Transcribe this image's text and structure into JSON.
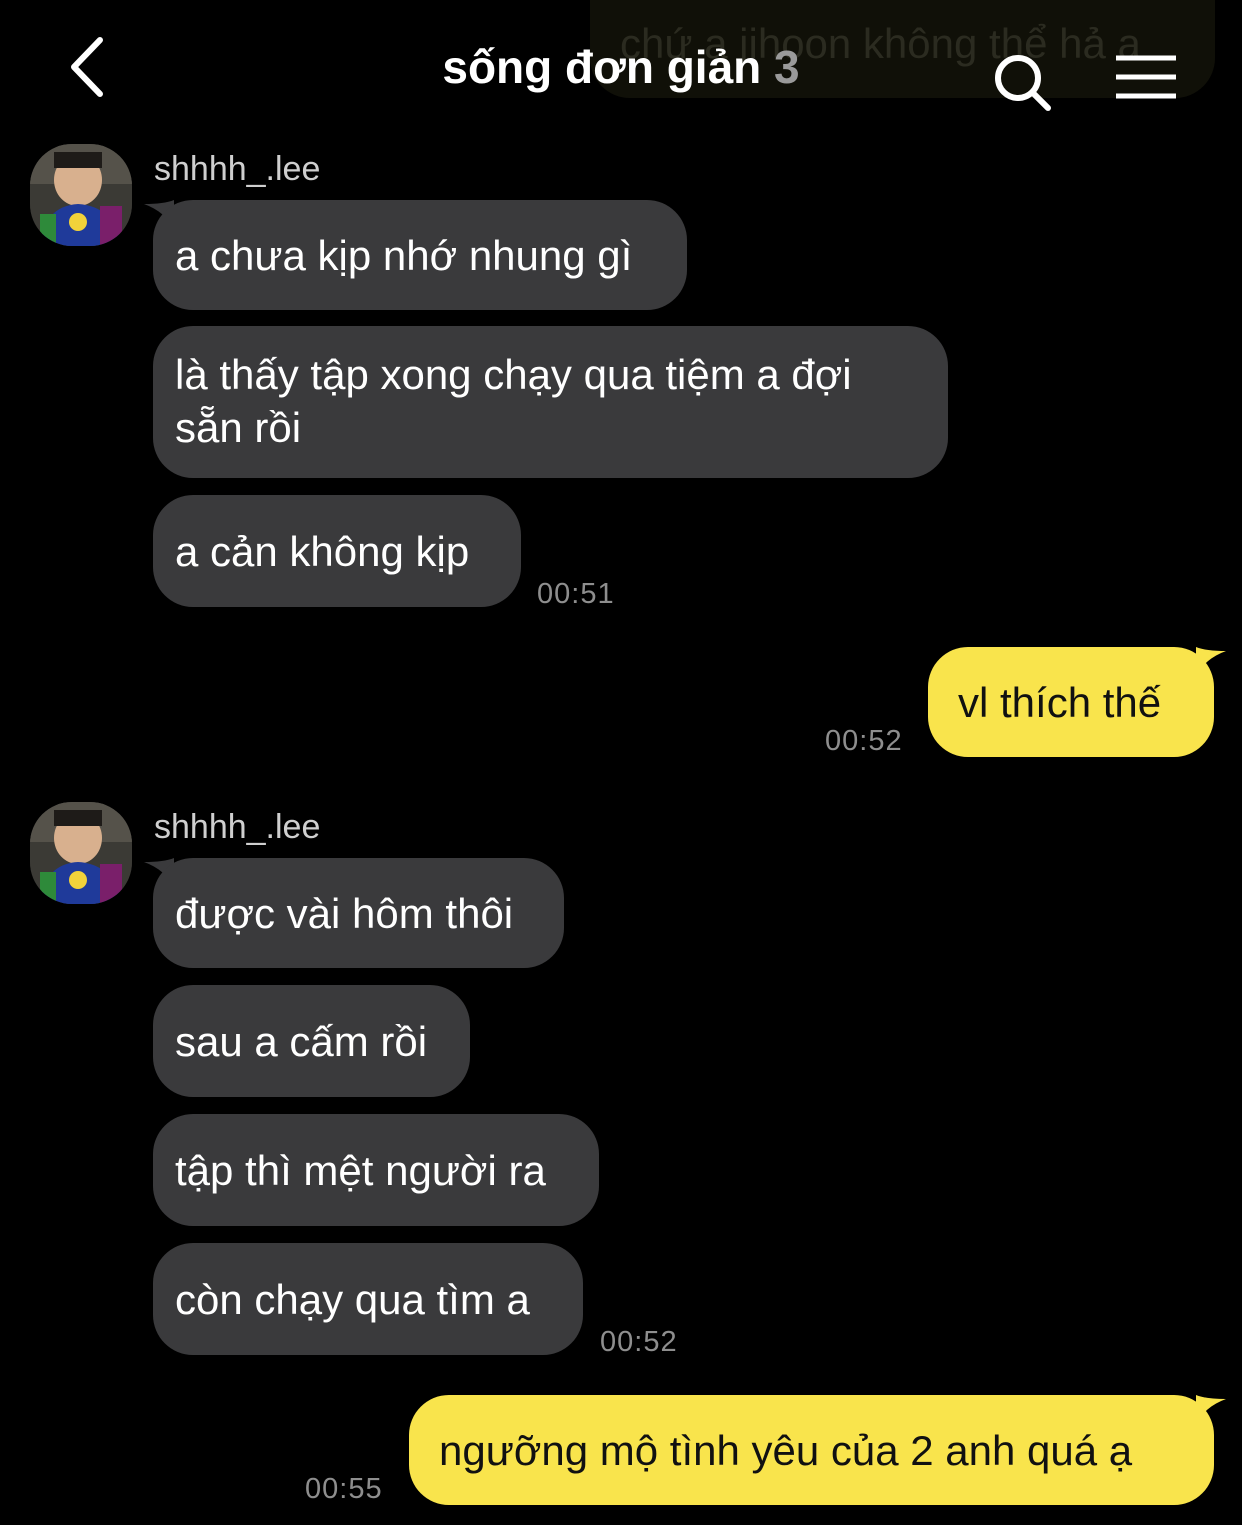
{
  "header": {
    "title": "sống đơn giản",
    "member_count": "3",
    "back_icon": "chevron-left-icon",
    "search_icon": "search-icon",
    "menu_icon": "hamburger-menu-icon",
    "faded_preview": "chứ a jihoon không thể hả a"
  },
  "colors": {
    "background": "#000000",
    "incoming_bubble": "#3a3a3c",
    "outgoing_bubble": "#f9e44c",
    "timestamp": "#8e8e8e"
  },
  "messages": {
    "group1": {
      "sender": "shhhh_.lee",
      "lines": [
        "a chưa kịp nhớ nhung gì",
        "là thấy tập xong chạy qua tiệm a đợi",
        "sẵn rồi",
        "a cản không kịp"
      ],
      "time": "00:51"
    },
    "mine1": {
      "text": "vl thích thế",
      "time": "00:52"
    },
    "group2": {
      "sender": "shhhh_.lee",
      "lines": [
        "được vài hôm thôi",
        "sau a cấm rồi",
        "tập thì mệt người ra",
        "còn chạy qua tìm a"
      ],
      "time": "00:52"
    },
    "mine2": {
      "text": "ngưỡng mộ tình yêu của 2 anh quá ạ",
      "time": "00:55"
    }
  }
}
